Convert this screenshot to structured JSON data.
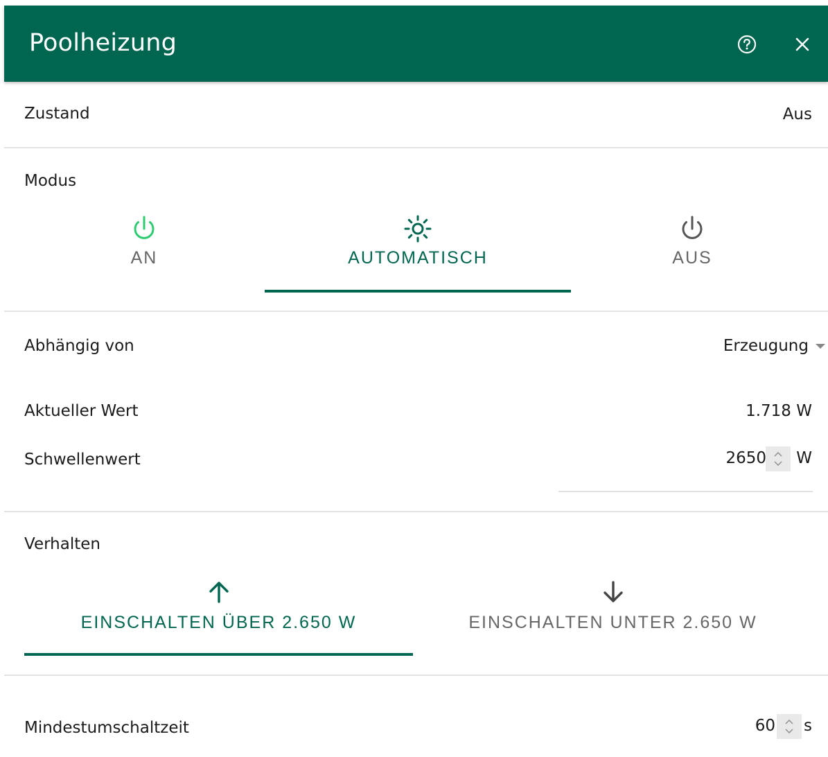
{
  "header": {
    "title": "Poolheizung",
    "help_icon": "help-circle-icon",
    "close_icon": "close-icon",
    "background": "#00664f"
  },
  "status": {
    "label": "Zustand",
    "value": "Aus"
  },
  "mode": {
    "label": "Modus",
    "tabs": [
      {
        "label": "AN",
        "icon": "power-icon",
        "color": "#2ecc71"
      },
      {
        "label": "AUTOMATISCH",
        "icon": "sun-icon",
        "color": "#00664f",
        "active": true
      },
      {
        "label": "AUS",
        "icon": "power-icon",
        "color": "#555555"
      }
    ]
  },
  "dependency": {
    "label": "Abhängig von",
    "selected": "Erzeugung"
  },
  "current_value": {
    "label": "Aktueller Wert",
    "value": "1.718 W"
  },
  "threshold": {
    "label": "Schwellenwert",
    "value": "2650",
    "unit": "W"
  },
  "behavior": {
    "label": "Verhalten",
    "tabs": [
      {
        "label": "EINSCHALTEN ÜBER 2.650 W",
        "icon": "arrow-up-icon",
        "active": true
      },
      {
        "label": "EINSCHALTEN UNTER 2.650 W",
        "icon": "arrow-down-icon"
      }
    ]
  },
  "min_switch_time": {
    "label": "Mindestumschaltzeit",
    "value": "60",
    "unit": "s"
  },
  "accent": "#00664f"
}
